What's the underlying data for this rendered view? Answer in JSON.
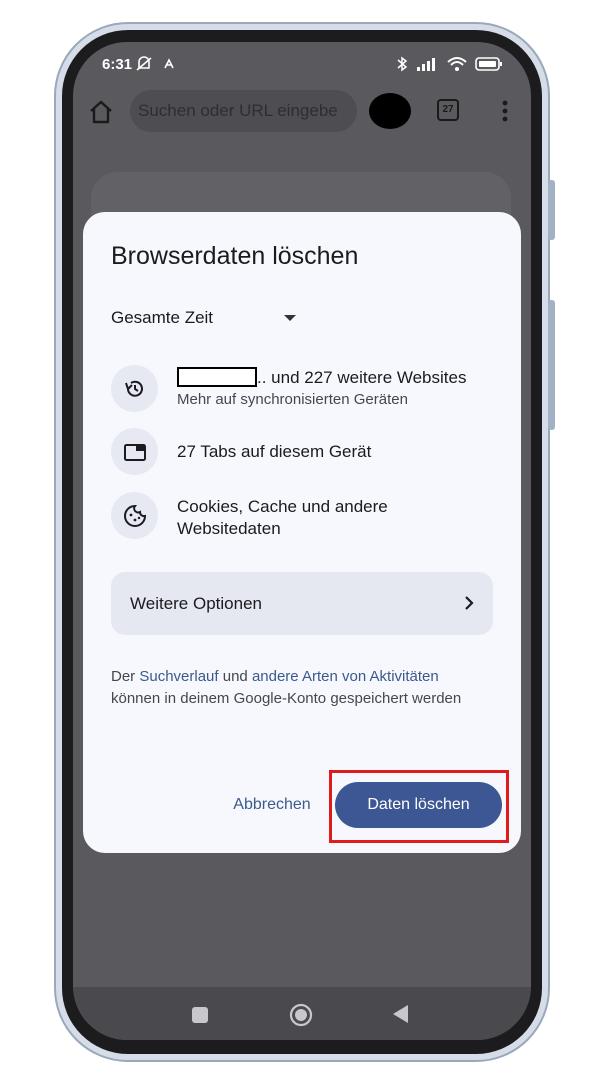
{
  "status_bar": {
    "time": "6:31",
    "left_icons": [
      "mute-icon",
      "auto-icon"
    ],
    "right_icons": [
      "bluetooth-icon",
      "signal-icon",
      "wifi-icon",
      "battery-icon"
    ]
  },
  "toolbar": {
    "url_placeholder": "Suchen oder URL eingebe",
    "tab_count": "27"
  },
  "dialog": {
    "title": "Browserdaten löschen",
    "time_range": "Gesamte Zeit",
    "items": [
      {
        "icon": "history-icon",
        "text_suffix": ".. und 227 weitere Websites",
        "subtext": "Mehr auf synchronisierten Geräten"
      },
      {
        "icon": "tab-icon",
        "text": "27 Tabs auf diesem Gerät"
      },
      {
        "icon": "cookie-icon",
        "text": "Cookies, Cache und andere Websitedaten"
      }
    ],
    "more_options": "Weitere Optionen",
    "info": {
      "part1": "Der ",
      "link1": "Suchverlauf",
      "part2": " und ",
      "link2": "andere Arten von Aktivitäten",
      "part3": " können in deinem Google-Konto gespeichert werden"
    },
    "cancel_label": "Abbrechen",
    "confirm_label": "Daten löschen"
  },
  "colors": {
    "primary": "#3d5795",
    "highlight": "#e01b1b",
    "dialog_bg": "#f7f8fd"
  }
}
